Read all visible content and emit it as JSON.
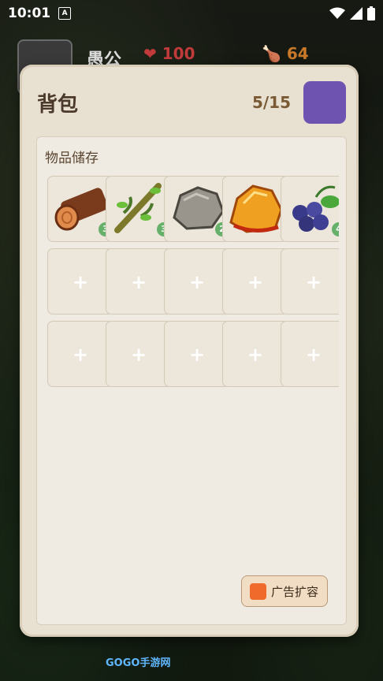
{
  "status_bar": {
    "time": "10:01",
    "notif_icon_letter": "A"
  },
  "hud": {
    "name": "愚公",
    "hp": "100",
    "food": "64"
  },
  "modal": {
    "title": "背包",
    "capacity": "5/15",
    "storage_label": "物品储存",
    "expand_button_label": "广告扩容",
    "close_color": "#6e54b0"
  },
  "items": [
    {
      "icon": "log-icon",
      "count": "3"
    },
    {
      "icon": "vine-icon",
      "count": "3"
    },
    {
      "icon": "stone-icon",
      "count": "2"
    },
    {
      "icon": "amber-icon",
      "count": ""
    },
    {
      "icon": "berries-icon",
      "count": "4"
    }
  ],
  "empty_slot_symbol": "+",
  "watermark": "GOGO手游网"
}
